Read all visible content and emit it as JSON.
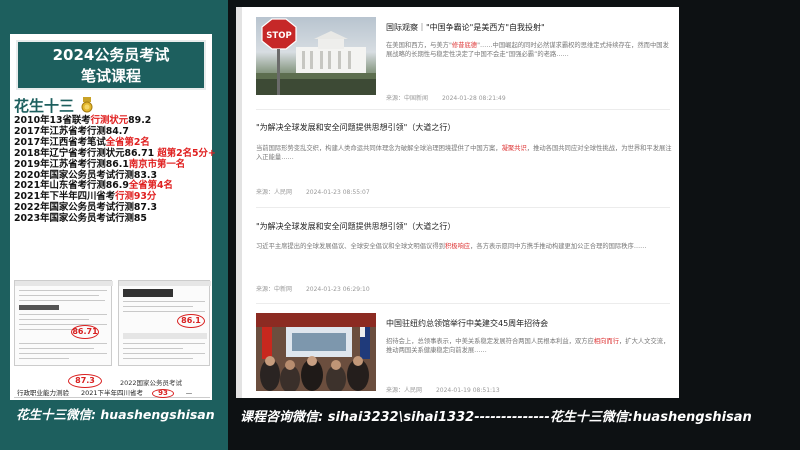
{
  "promo": {
    "title_line1": "2024公务员考试",
    "title_line2": "笔试课程",
    "brand": "花生十三",
    "achievements": [
      {
        "pre": "2010年13省联考",
        "hl": "行测状元",
        "post": "89.2"
      },
      {
        "pre": "2017年江苏省考行测84.7",
        "hl": "",
        "post": ""
      },
      {
        "pre": "2017年江西省考笔试",
        "hl": "全省第2名",
        "post": ""
      },
      {
        "pre": "2018年辽宁省考行测状元86.71 ",
        "hl": "超第2名5分+",
        "post": ""
      },
      {
        "pre": "2019年江苏省考行测86.1",
        "hl": "南京市第一名",
        "post": ""
      },
      {
        "pre": "2020年国家公务员考试行测83.3",
        "hl": "",
        "post": ""
      },
      {
        "pre": "2021年山东省考行测86.9",
        "hl": "全省第4名",
        "post": ""
      },
      {
        "pre": "2021年下半年四川省考",
        "hl": "行测93分",
        "post": ""
      },
      {
        "pre": "2022年国家公务员考试行测87.3",
        "hl": "",
        "post": ""
      },
      {
        "pre": "2023年国家公务员考试行测85",
        "hl": "",
        "post": ""
      }
    ],
    "score_doc1_circle": "86.71",
    "score_doc2_circle": "86.1",
    "score_doc3_circle": "87.3",
    "score_doc3_caption": "2022国家公务员考试",
    "table_row1": [
      "科目",
      "成绩",
      "—"
    ],
    "table_row2": [
      "行政职业能力测验",
      "2021下半年四川省考",
      "93",
      "—"
    ],
    "table_row3": [
      "申论",
      "",
      "—",
      ""
    ],
    "footer": "花生十三微信: huashengshisan"
  },
  "news": {
    "articles": [
      {
        "title": "国际观察｜\"中国争霸论\"是美西方\"自我投射\"",
        "summary_pre": "在美国和西方，与美方\"",
        "summary_hl": "修昔底德",
        "summary_post": "\"……中国崛起的同时必然谋求霸权的思维定式持续存在，然而中国发展战略的长期性与稳定性决定了中国不会走“国强必霸”的老路……",
        "source": "来源：中国新闻",
        "date": "2024-01-28 08:21:49"
      },
      {
        "title": "\"为解决全球发展和安全问题提供思想引领\"（大道之行）",
        "summary_pre": "当前国际形势变乱交织，构建人类命运共同体理念为破解全球治理困境提供了中国方案，",
        "summary_hl": "凝聚共识",
        "summary_post": "，推动各国共同应对全球性挑战，为世界和平发展注入正能量……",
        "source": "来源：人民网",
        "date": "2024-01-23 08:55:07"
      },
      {
        "title": "\"为解决全球发展和安全问题提供思想引领\"（大道之行）",
        "summary_pre": "习近平主席提出的全球发展倡议、全球安全倡议和全球文明倡议得到",
        "summary_hl": "积极响应",
        "summary_post": "，各方表示愿同中方携手推动构建更加公正合理的国际秩序……",
        "source": "来源：中新网",
        "date": "2024-01-23 06:29:10"
      },
      {
        "title": "中国驻纽约总领馆举行中美建交45周年招待会",
        "summary_pre": "招待会上，总领事表示，中美关系稳定发展符合两国人民根本利益，双方应",
        "summary_hl": "相向而行",
        "summary_post": "，扩大人文交流，推动两国关系健康稳定向前发展……",
        "source": "来源：人民网",
        "date": "2024-01-19 08:51:13"
      }
    ]
  },
  "bottom_caption": "课程咨询微信: sihai3232\\sihai1332--------------花生十三微信:huashengshisan"
}
